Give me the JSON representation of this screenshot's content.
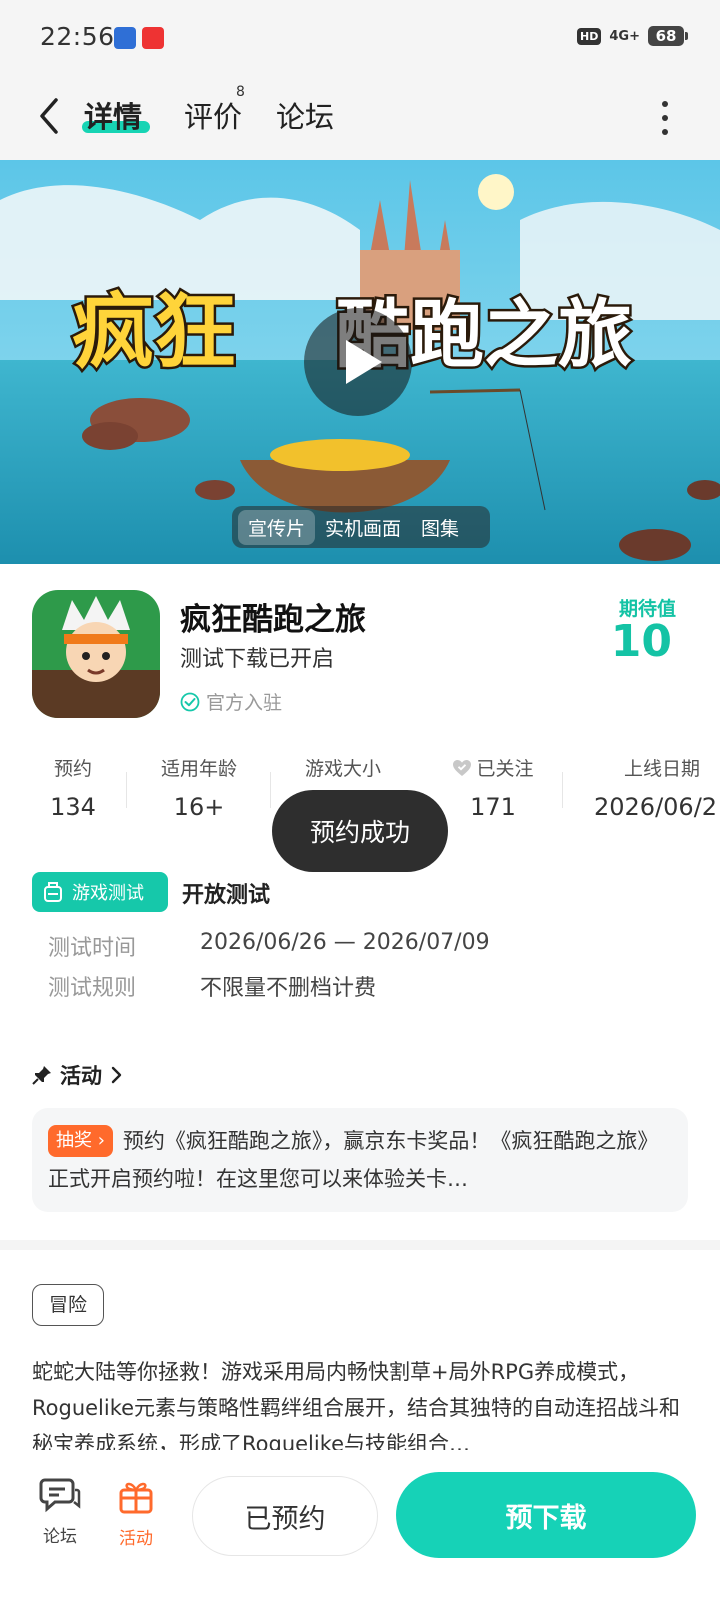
{
  "status_bar": {
    "time": "22:56",
    "hd": "HD",
    "network": "4G+",
    "battery": "68"
  },
  "header": {
    "tabs": [
      {
        "label": "详情",
        "active": true
      },
      {
        "label": "评价",
        "count": "8"
      },
      {
        "label": "论坛"
      }
    ]
  },
  "banner": {
    "media_tabs": [
      "宣传片",
      "实机画面",
      "图集"
    ]
  },
  "game": {
    "title": "疯狂酷跑之旅",
    "subtitle": "测试下载已开启",
    "official": "官方入驻",
    "expect_label": "期待值",
    "expect_value": "10"
  },
  "stats": [
    {
      "label": "预约",
      "value": "134"
    },
    {
      "label": "适用年龄",
      "value": "16+"
    },
    {
      "label": "游戏大小",
      "value": ""
    },
    {
      "label": "已关注",
      "value": "171"
    },
    {
      "label": "上线日期",
      "value": "2026/06/2"
    }
  ],
  "toast": "预约成功",
  "test": {
    "badge": "游戏测试",
    "type": "开放测试",
    "rows": [
      {
        "label": "测试时间",
        "value": "2026/06/26 — 2026/07/09"
      },
      {
        "label": "测试规则",
        "value": "不限量不删档计费"
      }
    ]
  },
  "activity": {
    "title": "活动",
    "badge": "抽奖",
    "text": "预约《疯狂酷跑之旅》，赢京东卡奖品！《疯狂酷跑之旅》正式开启预约啦！在这里您可以来体验关卡…"
  },
  "description": {
    "tag": "冒险",
    "text": "蛇蛇大陆等你拯救！游戏采用局内畅快割草+局外RPG养成模式，Roguelike元素与策略性羁绊组合展开，结合其独特的自动连招战斗和秘宝养成系统，形成了Roguelike与技能组合…"
  },
  "bottom_bar": {
    "forum_label": "论坛",
    "activity_label": "活动",
    "booked_label": "已预约",
    "predownload_label": "预下载"
  },
  "colors": {
    "accent": "#16d2b7",
    "orange": "#ff6a2c"
  }
}
